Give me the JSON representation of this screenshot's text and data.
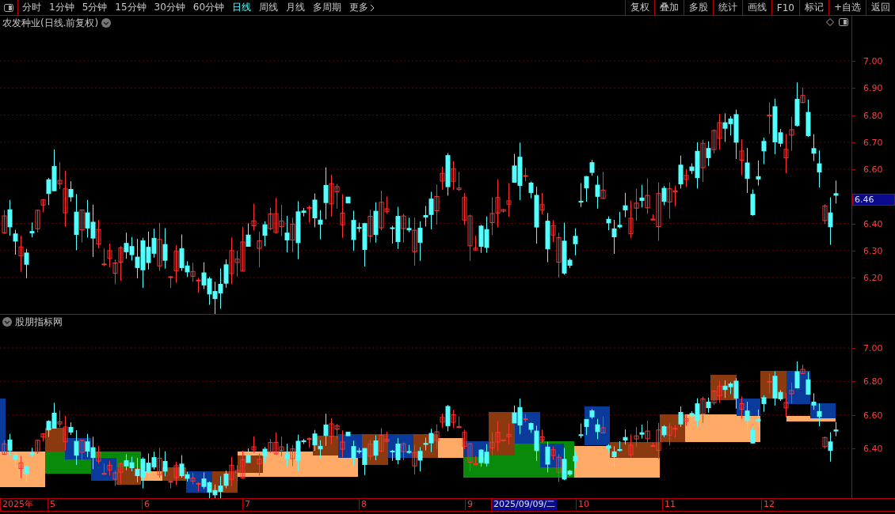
{
  "toolbar": {
    "periods": [
      {
        "label": "分时",
        "selected": false
      },
      {
        "label": "1分钟",
        "selected": false
      },
      {
        "label": "5分钟",
        "selected": false
      },
      {
        "label": "15分钟",
        "selected": false
      },
      {
        "label": "30分钟",
        "selected": false
      },
      {
        "label": "60分钟",
        "selected": false
      },
      {
        "label": "日线",
        "selected": true
      },
      {
        "label": "周线",
        "selected": false
      },
      {
        "label": "月线",
        "selected": false
      },
      {
        "label": "多周期",
        "selected": false
      },
      {
        "label": "更多",
        "selected": false
      }
    ],
    "buttons": [
      "复权",
      "叠加",
      "多股",
      "统计",
      "画线",
      "F10",
      "标记",
      "+自选",
      "返回"
    ]
  },
  "main_chart": {
    "title": "农发种业(日线.前复权)",
    "y_ticks": [
      "7.00",
      "6.90",
      "6.80",
      "6.70",
      "6.60",
      "6.40",
      "6.30",
      "6.20"
    ],
    "price_tag": "6.46"
  },
  "indicator": {
    "title": "股朋指标网",
    "y_ticks": [
      "7.00",
      "6.80",
      "6.60",
      "6.40"
    ]
  },
  "time_axis": {
    "labels": [
      {
        "label": "2025年",
        "selected": false
      },
      {
        "label": "5",
        "selected": false
      },
      {
        "label": "6",
        "selected": false
      },
      {
        "label": "7",
        "selected": false
      },
      {
        "label": "8",
        "selected": false
      },
      {
        "label": "9",
        "selected": false
      },
      {
        "label": "2025/09/09/二",
        "selected": true
      },
      {
        "label": "10",
        "selected": false
      },
      {
        "label": "11",
        "selected": false
      },
      {
        "label": "12",
        "selected": false
      }
    ]
  }
}
